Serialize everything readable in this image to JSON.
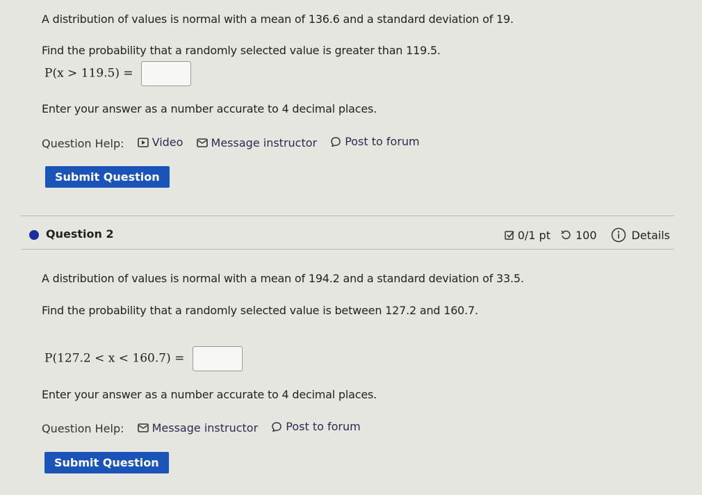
{
  "question1": {
    "statement": "A distribution of values is normal with a mean of 136.6 and a standard deviation of 19.",
    "prompt": "Find the probability that a randomly selected value is greater than 119.5.",
    "math_expression": "P(x > 119.5) =",
    "answer_value": "",
    "instructions": "Enter your answer as a number accurate to 4 decimal places.",
    "help_label": "Question Help:",
    "help_links": [
      "Video",
      "Message instructor",
      "Post to forum"
    ],
    "submit_label": "Submit Question"
  },
  "question2": {
    "title": "Question 2",
    "score": "0/1 pt",
    "retries": "100",
    "details_label": "Details",
    "statement": "A distribution of values is normal with a mean of 194.2 and a standard deviation of 33.5.",
    "prompt": "Find the probability that a randomly selected value is between 127.2 and 160.7.",
    "math_expression": "P(127.2 < x < 160.7) =",
    "answer_value": "",
    "instructions": "Enter your answer as a number accurate to 4 decimal places.",
    "help_label": "Question Help:",
    "help_links": [
      "Message instructor",
      "Post to forum"
    ],
    "submit_label": "Submit Question"
  },
  "colors": {
    "accent": "#1a54b8",
    "status_dot": "#1c2e9e",
    "background": "#e6e6e1"
  }
}
